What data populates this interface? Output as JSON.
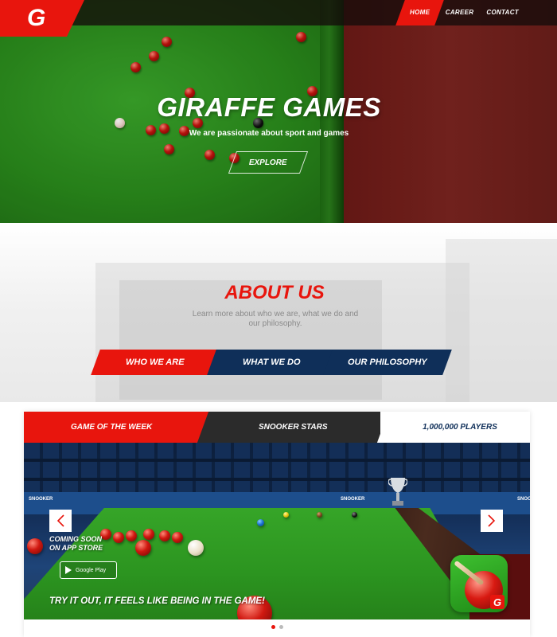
{
  "brand": {
    "logo_letter": "G",
    "accent": "#e8150d",
    "navy": "#0f2f59"
  },
  "nav": {
    "items": [
      {
        "label": "HOME",
        "active": true
      },
      {
        "label": "CAREER",
        "active": false
      },
      {
        "label": "CONTACT",
        "active": false
      }
    ]
  },
  "hero": {
    "title": "GIRAFFE GAMES",
    "subtitle": "We are passionate about sport and games",
    "button": "EXPLORE"
  },
  "about": {
    "title": "ABOUT US",
    "text": "Learn more about who we are, what we do and our philosophy.",
    "tabs": [
      "WHO WE ARE",
      "WHAT WE DO",
      "OUR PHILOSOPHY"
    ]
  },
  "game": {
    "tabs": [
      "GAME OF THE WEEK",
      "SNOOKER STARS",
      "1,000,000 PLAYERS"
    ],
    "coming_soon_line1": "COMING SOON",
    "coming_soon_line2": "ON APP STORE",
    "google_play": "Google Play",
    "tagline": "TRY IT OUT, IT FEELS LIKE BEING IN THE GAME!",
    "banner_text": "SNOOKER",
    "app_icon_letter": "G",
    "prev_icon": "chevron-left-icon",
    "next_icon": "chevron-right-icon",
    "slides": 2,
    "active_slide": 1
  }
}
